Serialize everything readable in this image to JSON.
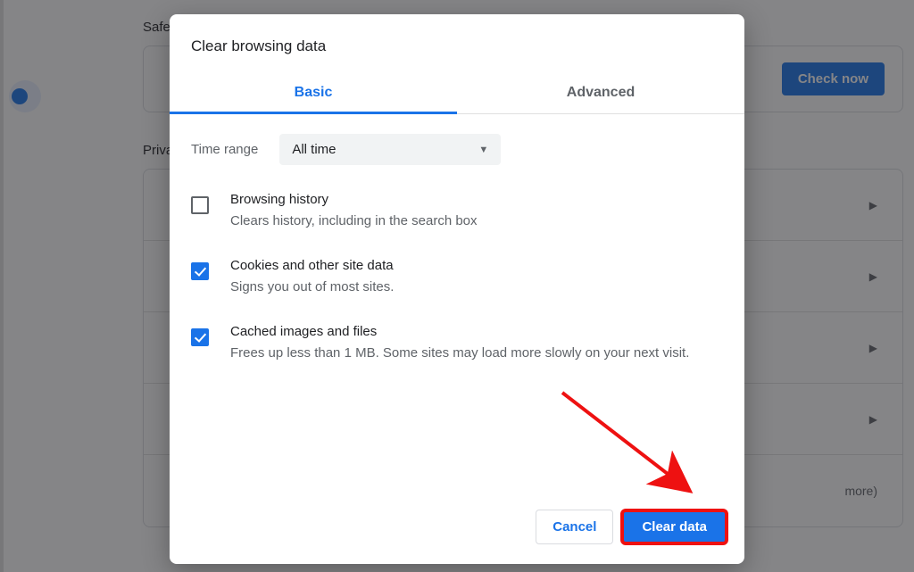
{
  "bg": {
    "section1_heading": "Safety check",
    "check_now_label": "Check now",
    "section2_heading": "Privacy and security",
    "more_suffix": "more)"
  },
  "dialog": {
    "title": "Clear browsing data",
    "tabs": {
      "basic": "Basic",
      "advanced": "Advanced",
      "active": "basic"
    },
    "time_range": {
      "label": "Time range",
      "value": "All time"
    },
    "options": [
      {
        "checked": false,
        "title": "Browsing history",
        "desc": "Clears history, including in the search box"
      },
      {
        "checked": true,
        "title": "Cookies and other site data",
        "desc": "Signs you out of most sites."
      },
      {
        "checked": true,
        "title": "Cached images and files",
        "desc": "Frees up less than 1 MB. Some sites may load more slowly on your next visit."
      }
    ],
    "buttons": {
      "cancel": "Cancel",
      "clear": "Clear data"
    }
  },
  "annotation": {
    "color": "#e11",
    "target": "clear-data-button"
  }
}
